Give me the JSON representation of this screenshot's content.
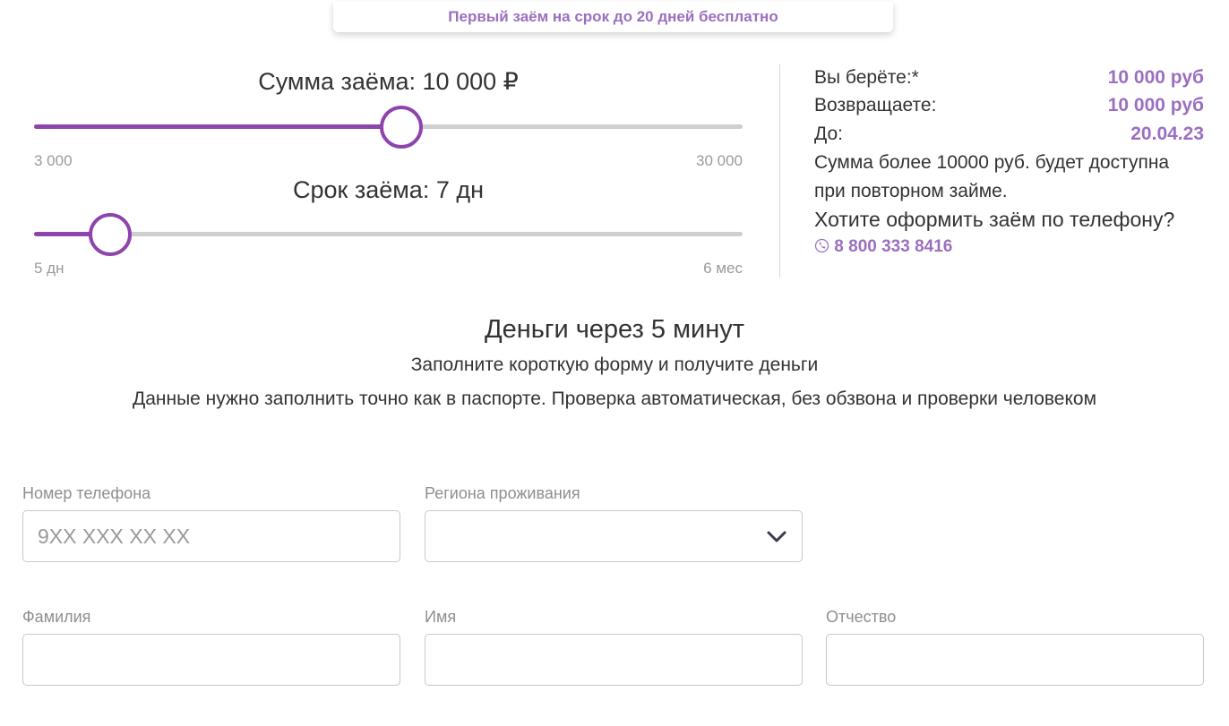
{
  "promo": {
    "text": "Первый заём на срок до 20 дней бесплатно"
  },
  "amount_slider": {
    "title": "Сумма заёма: 10 000 ₽",
    "min_label": "3 000",
    "max_label": "30 000",
    "value": 10000,
    "min": 3000,
    "max": 30000,
    "fraction": 0.518
  },
  "term_slider": {
    "title": "Срок заёма: 7 дн",
    "min_label": "5 дн",
    "max_label": "6 мес",
    "fraction": 0.107
  },
  "summary": {
    "take_label": "Вы берёте:*",
    "take_value": "10 000 руб",
    "return_label": "Возвращаете:",
    "return_value": "10 000 руб",
    "until_label": "До:",
    "until_value": "20.04.23",
    "note_line1": "Сумма более 10000 руб. будет доступна",
    "note_line2": "при повторном займе.",
    "phone_question": "Хотите оформить заём по телефону?",
    "phone_number": "8 800 333 8416",
    "phone_icon": "phone-icon"
  },
  "info": {
    "heading": "Деньги через 5 минут",
    "subtitle": "Заполните короткую форму и получите деньги",
    "hint": "Данные нужно заполнить точно как в паспорте. Проверка автоматическая, без обзвона и проверки человеком"
  },
  "form": {
    "phone_label": "Номер телефона",
    "phone_placeholder": "9XX XXX XX XX",
    "phone_value": "",
    "region_label": "Региона проживания",
    "region_value": "",
    "lastname_label": "Фамилия",
    "lastname_value": "",
    "firstname_label": "Имя",
    "firstname_value": "",
    "patronymic_label": "Отчество",
    "patronymic_value": ""
  },
  "colors": {
    "accent": "#8e44ad",
    "accent_text": "#9b6fbf",
    "track": "#cfcfcf"
  }
}
